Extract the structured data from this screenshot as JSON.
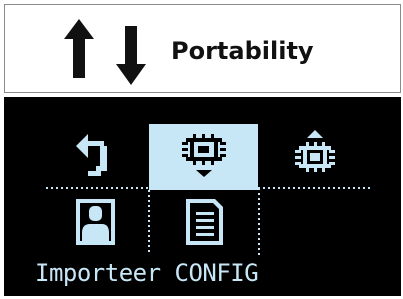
{
  "header": {
    "title": "Portability",
    "icon": "up-down-arrows-icon"
  },
  "screen": {
    "colors": {
      "background": "#000000",
      "foreground": "#c7e7f7",
      "highlight": "#c7e7f7"
    },
    "menu": [
      {
        "icon": "back-arrow-icon",
        "selected": false
      },
      {
        "icon": "chip-download-icon",
        "selected": true
      },
      {
        "icon": "chip-upload-icon",
        "selected": false
      },
      {
        "icon": "user-portrait-icon",
        "selected": false
      },
      {
        "icon": "document-icon",
        "selected": false
      }
    ],
    "caption": "Importeer CONFIG"
  }
}
